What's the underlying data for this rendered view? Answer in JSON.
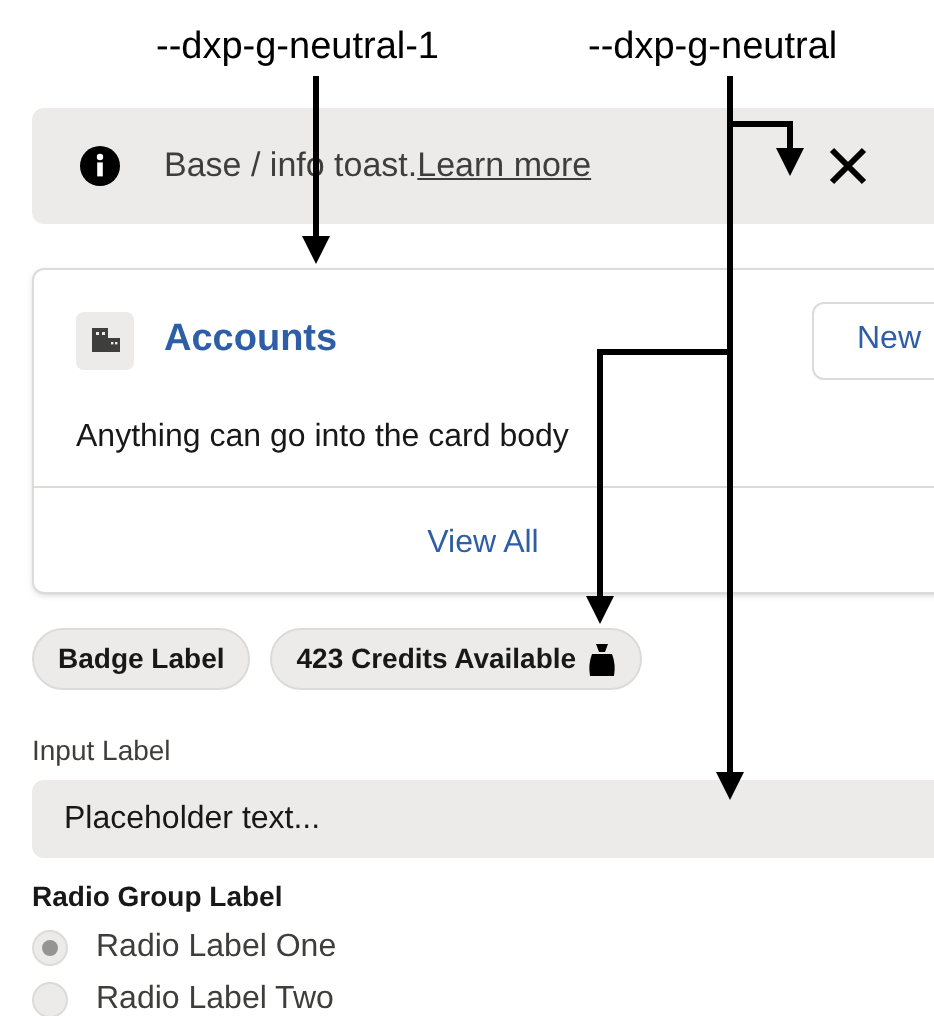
{
  "annotations": [
    {
      "label": "--dxp-g-neutral-1"
    },
    {
      "label": "--dxp-g-neutral"
    }
  ],
  "toast": {
    "text": "Base / info toast.",
    "link": "Learn more"
  },
  "card": {
    "title": "Accounts",
    "action": "New",
    "body": "Anything can go into the card body",
    "footer": "View All"
  },
  "badges": [
    {
      "label": "Badge Label",
      "kind": "plain"
    },
    {
      "label": "423 Credits Available",
      "kind": "money"
    }
  ],
  "input": {
    "label": "Input Label",
    "placeholder": "Placeholder text..."
  },
  "radio_group": {
    "label": "Radio Group Label",
    "options": [
      {
        "label": "Radio Label One",
        "selected": true
      },
      {
        "label": "Radio Label Two",
        "selected": false
      }
    ]
  }
}
